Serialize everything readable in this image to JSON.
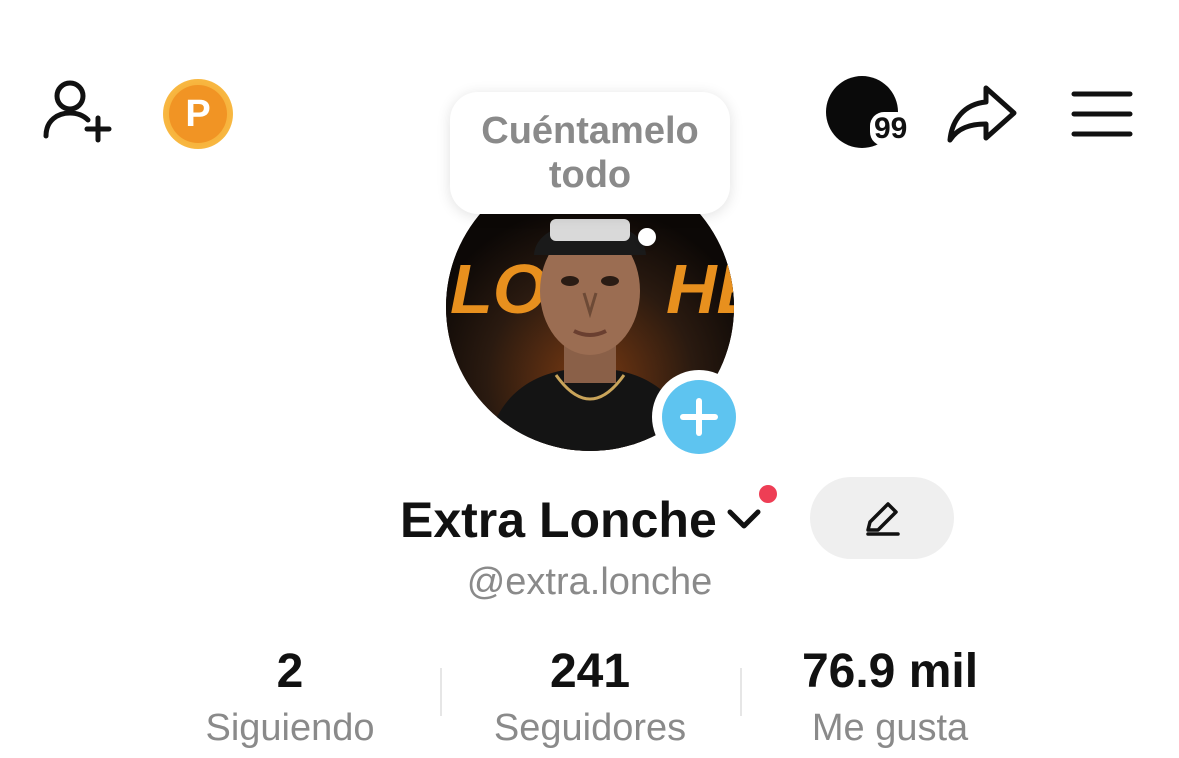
{
  "header": {
    "add_friend_icon": "person-add-icon",
    "points_icon": "coin-p-icon",
    "points_letter": "P",
    "inbox_badge": "99",
    "share_icon": "share-arrow-icon",
    "menu_icon": "hamburger-menu-icon"
  },
  "bubble": {
    "text": "Cuéntamelo todo"
  },
  "profile": {
    "display_name": "Extra Lonche",
    "username": "@extra.lonche",
    "avatar_text": "LONCHE",
    "add_story_icon": "plus-icon",
    "edit_icon": "pencil-icon",
    "switch_account_icon": "chevron-down-icon"
  },
  "stats": [
    {
      "value": "2",
      "label": "Siguiendo"
    },
    {
      "value": "241",
      "label": "Seguidores"
    },
    {
      "value": "76.9 mil",
      "label": "Me gusta"
    }
  ],
  "colors": {
    "accent_blue": "#5ec4f0",
    "notification_red": "#ee3e55",
    "coin_orange": "#f19424",
    "secondary_text": "#8a8a8a"
  }
}
